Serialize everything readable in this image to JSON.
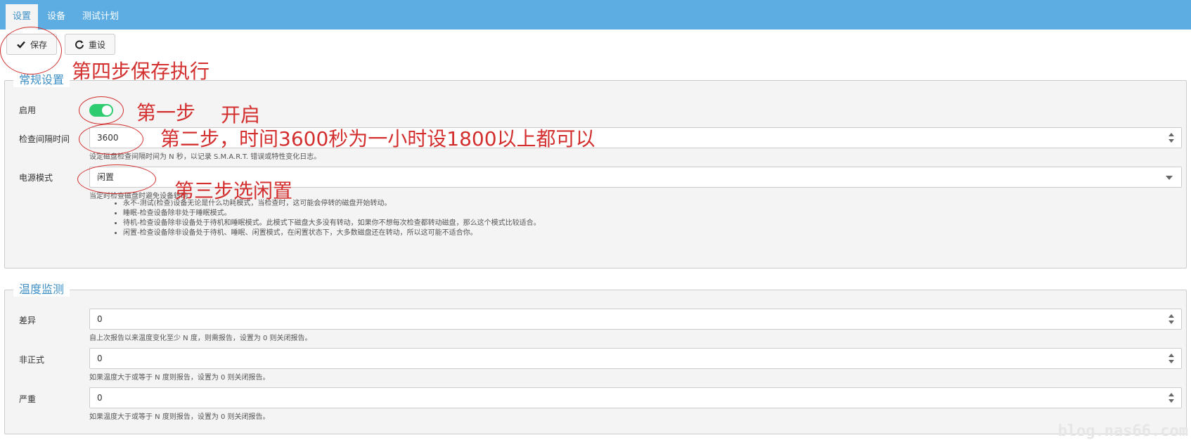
{
  "nav": {
    "tabs": [
      {
        "label": "设置",
        "active": true
      },
      {
        "label": "设备",
        "active": false
      },
      {
        "label": "测试计划",
        "active": false
      }
    ]
  },
  "toolbar": {
    "save_label": "保存",
    "reset_label": "重设",
    "save_icon": "check-icon",
    "reset_icon": "refresh-icon"
  },
  "general": {
    "legend": "常规设置",
    "enable_label": "启用",
    "enable_on": true,
    "interval_label": "检查间隔时间",
    "interval_value": "3600",
    "interval_help": "设定磁盘检查间隔时间为 N 秒，以记录 S.M.A.R.T. 错误或特性变化日志。",
    "power_label": "电源模式",
    "power_value": "闲置",
    "power_help": "当定时检查磁盘时避免设备转动",
    "power_modes": [
      "永不-测试(检查)设备无论是什么功耗模式，当检查时，这可能会停转的磁盘开始转动。",
      "睡眠-检查设备除非处于睡眠模式。",
      "待机-检查设备除非设备处于待机和睡眠模式。此模式下磁盘大多没有转动，如果你不想每次检查都转动磁盘，那么这个模式比较适合。",
      "闲置-检查设备除非设备处于待机、睡眠、闲置模式，在闲置状态下，大多数磁盘还在转动，所以这可能不适合你。"
    ]
  },
  "temperature": {
    "legend": "温度监测",
    "diff_label": "差异",
    "diff_value": "0",
    "diff_help": "自上次报告以来温度变化至少 N 度，则需报告，设置为 0 则关闭报告。",
    "informal_label": "非正式",
    "informal_value": "0",
    "informal_help": "如果温度大于或等于 N 度则报告，设置为 0 则关闭报告。",
    "critical_label": "严重",
    "critical_value": "0",
    "critical_help": "如果温度大于或等于 N 度则报告，设置为 0 则关闭报告。"
  },
  "annotations": {
    "step4": "第四步保存执行",
    "step1": "第一步",
    "step1b": "开启",
    "step2": "第二步，时间3600秒为一小时设1800以上都可以",
    "step3": "第三步选闲置",
    "color": "#d32f2f"
  },
  "watermark": "blog.nas66.com",
  "colors": {
    "topbar": "#5dade2",
    "accent": "#3d8fc6",
    "toggle_on": "#2ecc71"
  }
}
